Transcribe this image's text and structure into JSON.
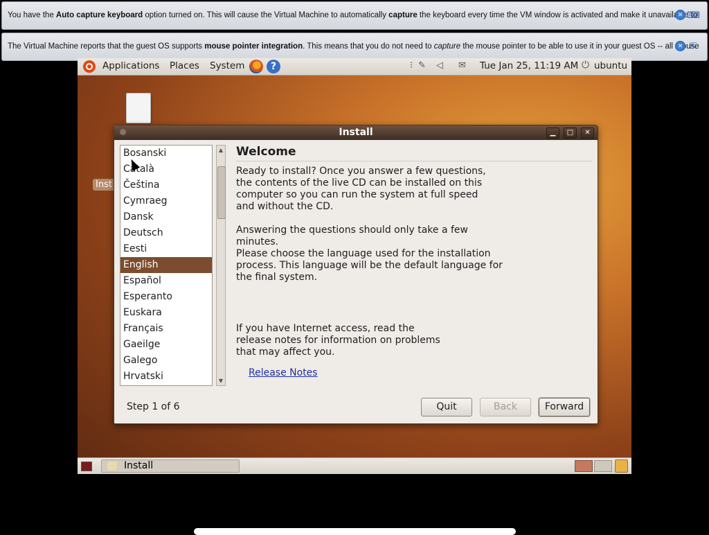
{
  "notifications": [
    {
      "before": "You have the ",
      "bold1": "Auto capture keyboard",
      "mid": " option turned on. This will cause the Virtual Machine to automatically ",
      "bold2": "capture",
      "after": " the keyboard every time the VM window is activated and make it unavailable to"
    },
    {
      "before": "The Virtual Machine reports that the guest OS supports ",
      "bold1": "mouse pointer integration",
      "mid": ". This means that you do not need to ",
      "italic": "capture",
      "after": " the mouse pointer to be able to use it in your guest OS -- all mouse"
    }
  ],
  "topbar": {
    "menus": [
      "Applications",
      "Places",
      "System"
    ],
    "clock": "Tue Jan 25, 11:19 AM",
    "user": "ubuntu"
  },
  "desktop": {
    "icon_label": "Inst"
  },
  "window": {
    "title": "Install",
    "languages": [
      "Bosanski",
      "Català",
      "Čeština",
      "Cymraeg",
      "Dansk",
      "Deutsch",
      "Eesti",
      "English",
      "Español",
      "Esperanto",
      "Euskara",
      "Français",
      "Gaeilge",
      "Galego",
      "Hrvatski"
    ],
    "selected_language": "English",
    "heading": "Welcome",
    "para1": "Ready to install? Once you answer a few questions, the contents of the live CD can be installed on this computer so you can run the system at full speed and without the CD.",
    "para2": "Answering the questions should only take a few minutes.",
    "para3": "Please choose the language used for the installation process. This language will be the default language for the final system.",
    "para4": "If you have Internet access, read the release notes for information on problems that may affect you.",
    "release_notes": "Release Notes",
    "step": "Step 1 of 6",
    "quit": "Quit",
    "back": "Back",
    "forward": "Forward"
  },
  "taskbar": {
    "task_label": "Install"
  },
  "colors": {
    "selection": "#7b4d2e",
    "titlebar": "#3f2d22",
    "link": "#1d2f9e"
  }
}
